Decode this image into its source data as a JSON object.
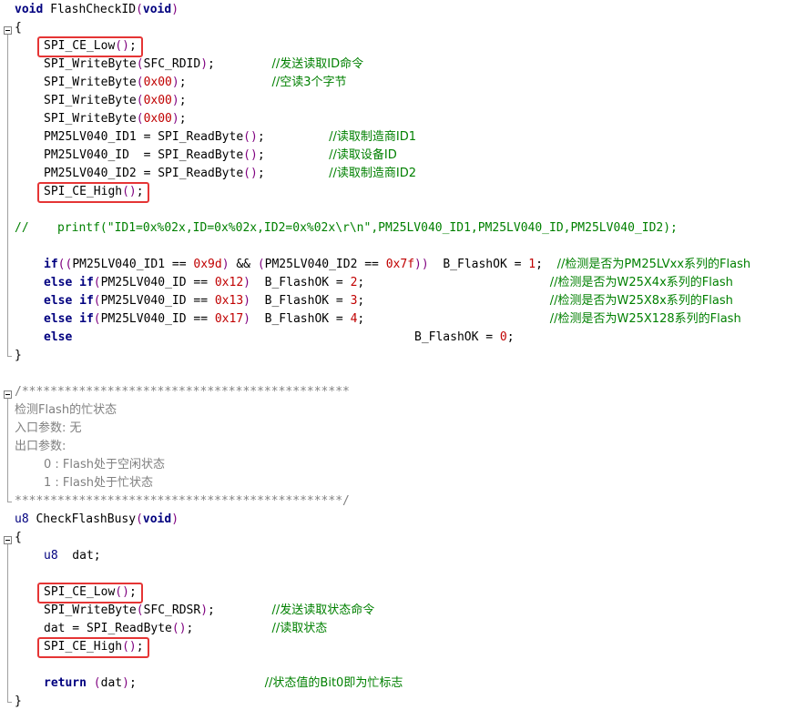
{
  "colors": {
    "keyword": "#00007f",
    "comment": "#008000",
    "number": "#c00000",
    "string": "#7f007f",
    "highlight_box": "#e53535"
  },
  "lines": [
    {
      "row": 0,
      "indent": 0,
      "tokens": [
        [
          "kw",
          "void"
        ],
        [
          "fn",
          " FlashCheckID"
        ],
        [
          "paren",
          "("
        ],
        [
          "kw",
          "void"
        ],
        [
          "paren",
          ")"
        ]
      ]
    },
    {
      "row": 1,
      "indent": 0,
      "tokens": [
        [
          "op",
          "{"
        ]
      ]
    },
    {
      "row": 2,
      "indent": 4,
      "tokens": [
        [
          "fn",
          "SPI_CE_Low"
        ],
        [
          "paren",
          "()"
        ],
        [
          "op",
          ";"
        ]
      ]
    },
    {
      "row": 3,
      "indent": 4,
      "tokens": [
        [
          "fn",
          "SPI_WriteByte"
        ],
        [
          "paren",
          "("
        ],
        [
          "fn",
          "SFC_RDID"
        ],
        [
          "paren",
          ")"
        ],
        [
          "op",
          ";        "
        ],
        [
          "cmt",
          "//发送读取ID命令"
        ]
      ]
    },
    {
      "row": 4,
      "indent": 4,
      "tokens": [
        [
          "fn",
          "SPI_WriteByte"
        ],
        [
          "paren",
          "("
        ],
        [
          "num",
          "0x00"
        ],
        [
          "paren",
          ")"
        ],
        [
          "op",
          ";            "
        ],
        [
          "cmt",
          "//空读3个字节"
        ]
      ]
    },
    {
      "row": 5,
      "indent": 4,
      "tokens": [
        [
          "fn",
          "SPI_WriteByte"
        ],
        [
          "paren",
          "("
        ],
        [
          "num",
          "0x00"
        ],
        [
          "paren",
          ")"
        ],
        [
          "op",
          ";"
        ]
      ]
    },
    {
      "row": 6,
      "indent": 4,
      "tokens": [
        [
          "fn",
          "SPI_WriteByte"
        ],
        [
          "paren",
          "("
        ],
        [
          "num",
          "0x00"
        ],
        [
          "paren",
          ")"
        ],
        [
          "op",
          ";"
        ]
      ]
    },
    {
      "row": 7,
      "indent": 4,
      "tokens": [
        [
          "fn",
          "PM25LV040_ID1 = SPI_ReadByte"
        ],
        [
          "paren",
          "()"
        ],
        [
          "op",
          ";         "
        ],
        [
          "cmt",
          "//读取制造商ID1"
        ]
      ]
    },
    {
      "row": 8,
      "indent": 4,
      "tokens": [
        [
          "fn",
          "PM25LV040_ID  = SPI_ReadByte"
        ],
        [
          "paren",
          "()"
        ],
        [
          "op",
          ";         "
        ],
        [
          "cmt",
          "//读取设备ID"
        ]
      ]
    },
    {
      "row": 9,
      "indent": 4,
      "tokens": [
        [
          "fn",
          "PM25LV040_ID2 = SPI_ReadByte"
        ],
        [
          "paren",
          "()"
        ],
        [
          "op",
          ";         "
        ],
        [
          "cmt",
          "//读取制造商ID2"
        ]
      ]
    },
    {
      "row": 10,
      "indent": 4,
      "tokens": [
        [
          "fn",
          "SPI_CE_High"
        ],
        [
          "paren",
          "()"
        ],
        [
          "op",
          ";"
        ]
      ]
    },
    {
      "row": 12,
      "indent": 0,
      "tokens": [
        [
          "cmt",
          "//    printf(\"ID1=0x%02x,ID=0x%02x,ID2=0x%02x\\r\\n\",PM25LV040_ID1,PM25LV040_ID,PM25LV040_ID2);"
        ]
      ]
    },
    {
      "row": 14,
      "indent": 4,
      "tokens": [
        [
          "kw",
          "if"
        ],
        [
          "paren",
          "(("
        ],
        [
          "fn",
          "PM25LV040_ID1 == "
        ],
        [
          "num",
          "0x9d"
        ],
        [
          "paren",
          ")"
        ],
        [
          "op",
          " && "
        ],
        [
          "paren",
          "("
        ],
        [
          "fn",
          "PM25LV040_ID2 == "
        ],
        [
          "num",
          "0x7f"
        ],
        [
          "paren",
          "))"
        ],
        [
          "op",
          "  B_FlashOK = "
        ],
        [
          "num",
          "1"
        ],
        [
          "op",
          ";  "
        ],
        [
          "cmt",
          "//检测是否为PM25LVxx系列的Flash"
        ]
      ]
    },
    {
      "row": 15,
      "indent": 4,
      "tokens": [
        [
          "kw",
          "else if"
        ],
        [
          "paren",
          "("
        ],
        [
          "fn",
          "PM25LV040_ID == "
        ],
        [
          "num",
          "0x12"
        ],
        [
          "paren",
          ")"
        ],
        [
          "op",
          "  B_FlashOK = "
        ],
        [
          "num",
          "2"
        ],
        [
          "op",
          ";                          "
        ],
        [
          "cmt",
          "//检测是否为W25X4x系列的Flash"
        ]
      ]
    },
    {
      "row": 16,
      "indent": 4,
      "tokens": [
        [
          "kw",
          "else if"
        ],
        [
          "paren",
          "("
        ],
        [
          "fn",
          "PM25LV040_ID == "
        ],
        [
          "num",
          "0x13"
        ],
        [
          "paren",
          ")"
        ],
        [
          "op",
          "  B_FlashOK = "
        ],
        [
          "num",
          "3"
        ],
        [
          "op",
          ";                          "
        ],
        [
          "cmt",
          "//检测是否为W25X8x系列的Flash"
        ]
      ]
    },
    {
      "row": 17,
      "indent": 4,
      "tokens": [
        [
          "kw",
          "else if"
        ],
        [
          "paren",
          "("
        ],
        [
          "fn",
          "PM25LV040_ID == "
        ],
        [
          "num",
          "0x17"
        ],
        [
          "paren",
          ")"
        ],
        [
          "op",
          "  B_FlashOK = "
        ],
        [
          "num",
          "4"
        ],
        [
          "op",
          ";                          "
        ],
        [
          "cmt",
          "//检测是否为W25X128系列的Flash"
        ]
      ]
    },
    {
      "row": 18,
      "indent": 4,
      "tokens": [
        [
          "kw",
          "else"
        ],
        [
          "op",
          "                                                "
        ],
        [
          "fn",
          "B_FlashOK = "
        ],
        [
          "num",
          "0"
        ],
        [
          "op",
          ";"
        ]
      ]
    },
    {
      "row": 19,
      "indent": 0,
      "tokens": [
        [
          "op",
          "}"
        ]
      ]
    },
    {
      "row": 21,
      "indent": 0,
      "tokens": [
        [
          "blk",
          "/**********************************************"
        ]
      ]
    },
    {
      "row": 22,
      "indent": 0,
      "tokens": [
        [
          "blk",
          "检测Flash的忙状态"
        ]
      ]
    },
    {
      "row": 23,
      "indent": 0,
      "tokens": [
        [
          "blk",
          "入口参数: 无"
        ]
      ]
    },
    {
      "row": 24,
      "indent": 0,
      "tokens": [
        [
          "blk",
          "出口参数:"
        ]
      ]
    },
    {
      "row": 25,
      "indent": 4,
      "tokens": [
        [
          "blk",
          "0 : Flash处于空闲状态"
        ]
      ]
    },
    {
      "row": 26,
      "indent": 4,
      "tokens": [
        [
          "blk",
          "1 : Flash处于忙状态"
        ]
      ]
    },
    {
      "row": 27,
      "indent": 0,
      "tokens": [
        [
          "blk",
          "**********************************************/"
        ]
      ]
    },
    {
      "row": 28,
      "indent": 0,
      "tokens": [
        [
          "ty",
          "u8"
        ],
        [
          "fn",
          " CheckFlashBusy"
        ],
        [
          "paren",
          "("
        ],
        [
          "kw",
          "void"
        ],
        [
          "paren",
          ")"
        ]
      ]
    },
    {
      "row": 29,
      "indent": 0,
      "tokens": [
        [
          "op",
          "{"
        ]
      ]
    },
    {
      "row": 30,
      "indent": 4,
      "tokens": [
        [
          "ty",
          "u8"
        ],
        [
          "fn",
          "  dat"
        ],
        [
          "op",
          ";"
        ]
      ]
    },
    {
      "row": 32,
      "indent": 4,
      "tokens": [
        [
          "fn",
          "SPI_CE_Low"
        ],
        [
          "paren",
          "()"
        ],
        [
          "op",
          ";"
        ]
      ]
    },
    {
      "row": 33,
      "indent": 4,
      "tokens": [
        [
          "fn",
          "SPI_WriteByte"
        ],
        [
          "paren",
          "("
        ],
        [
          "fn",
          "SFC_RDSR"
        ],
        [
          "paren",
          ")"
        ],
        [
          "op",
          ";        "
        ],
        [
          "cmt",
          "//发送读取状态命令"
        ]
      ]
    },
    {
      "row": 34,
      "indent": 4,
      "tokens": [
        [
          "fn",
          "dat = SPI_ReadByte"
        ],
        [
          "paren",
          "()"
        ],
        [
          "op",
          ";           "
        ],
        [
          "cmt",
          "//读取状态"
        ]
      ]
    },
    {
      "row": 35,
      "indent": 4,
      "tokens": [
        [
          "fn",
          "SPI_CE_High"
        ],
        [
          "paren",
          "()"
        ],
        [
          "op",
          ";"
        ]
      ]
    },
    {
      "row": 37,
      "indent": 4,
      "tokens": [
        [
          "kw",
          "return"
        ],
        [
          "op",
          " "
        ],
        [
          "paren",
          "("
        ],
        [
          "fn",
          "dat"
        ],
        [
          "paren",
          ")"
        ],
        [
          "op",
          ";                  "
        ],
        [
          "cmt",
          "//状态值的Bit0即为忙标志"
        ]
      ]
    },
    {
      "row": 38,
      "indent": 0,
      "tokens": [
        [
          "op",
          "}"
        ]
      ]
    }
  ],
  "highlights": [
    2,
    10,
    32,
    35
  ]
}
